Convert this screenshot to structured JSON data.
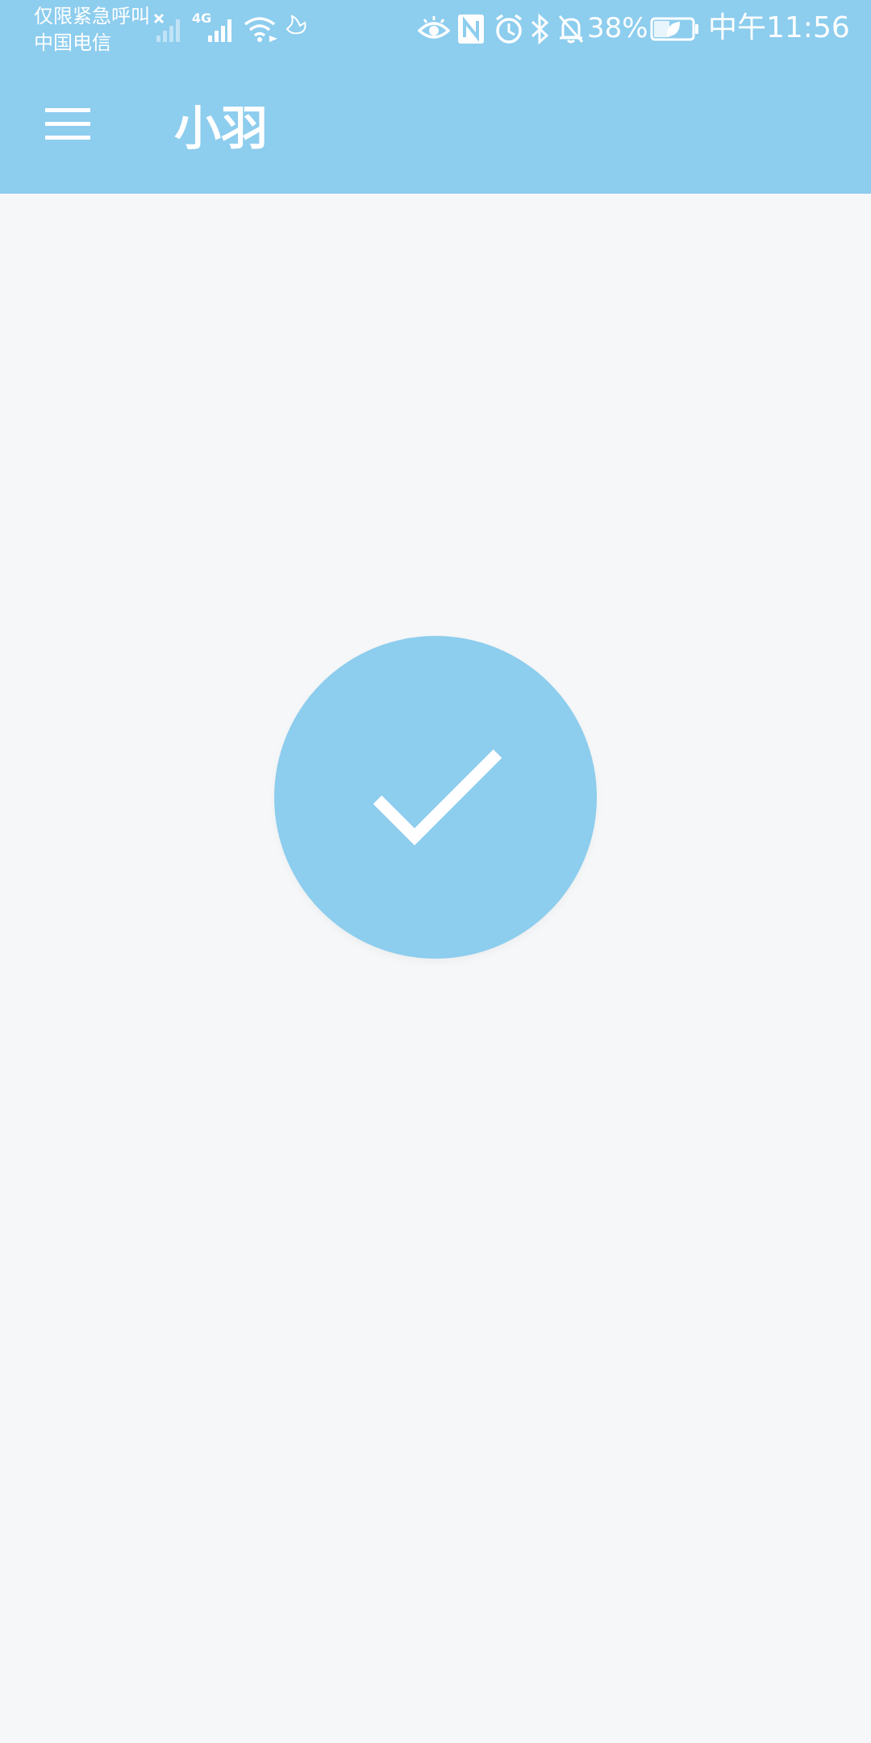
{
  "status_bar": {
    "carrier_line_1": "仅限紧急呼叫",
    "carrier_line_2": "中国电信",
    "network_type": "4G",
    "battery_percent": "38%",
    "time": "中午11:56",
    "icons": [
      "no-signal-icon",
      "signal-4g-icon",
      "wifi-icon",
      "bird-icon",
      "eye-icon",
      "nfc-icon",
      "alarm-icon",
      "bluetooth-icon",
      "mute-icon",
      "battery-icon"
    ]
  },
  "app_bar": {
    "title": "小羽",
    "menu_icon": "menu-icon",
    "color": "#8dcdee"
  },
  "main": {
    "status_icon": "check-icon",
    "circle_color": "#8dcdee",
    "background": "#f5f7f8"
  }
}
